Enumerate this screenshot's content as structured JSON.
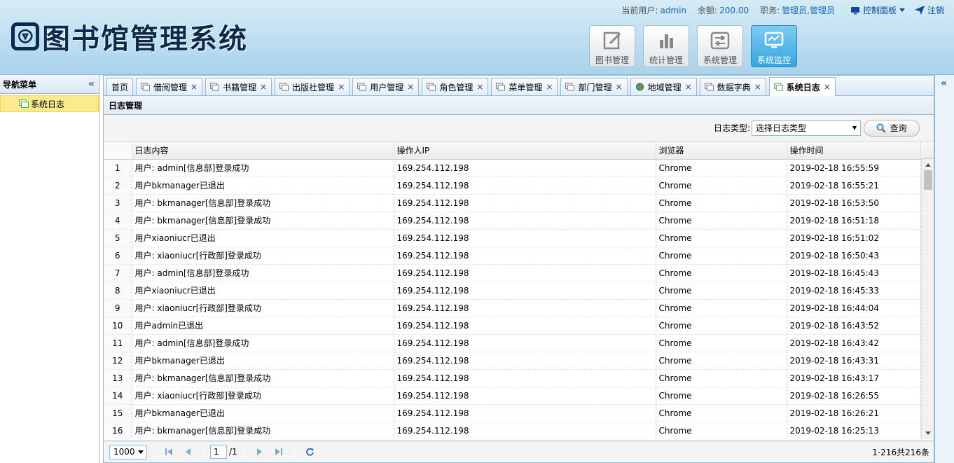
{
  "header": {
    "title": "图书馆管理系统",
    "user_label": "当前用户:",
    "user_value": "admin",
    "balance_label": "余额:",
    "balance_value": "200.00",
    "role_label": "职务:",
    "role_value": "管理员,管理员",
    "control_panel": "控制面板",
    "logout": "注销"
  },
  "modules": [
    {
      "label": "图书管理",
      "icon": "edit-icon"
    },
    {
      "label": "统计管理",
      "icon": "bar-chart-icon"
    },
    {
      "label": "系统管理",
      "icon": "sliders-icon"
    },
    {
      "label": "系统监控",
      "icon": "monitor-icon",
      "active": true
    }
  ],
  "sidebar": {
    "title": "导航菜单",
    "items": [
      {
        "label": "系统日志"
      }
    ]
  },
  "tabs": [
    {
      "label": "首页",
      "closable": false
    },
    {
      "label": "借阅管理",
      "closable": true
    },
    {
      "label": "书籍管理",
      "closable": true
    },
    {
      "label": "出版社管理",
      "closable": true
    },
    {
      "label": "用户管理",
      "closable": true
    },
    {
      "label": "角色管理",
      "closable": true
    },
    {
      "label": "菜单管理",
      "closable": true
    },
    {
      "label": "部门管理",
      "closable": true
    },
    {
      "label": "地域管理",
      "closable": true,
      "globe": true
    },
    {
      "label": "数据字典",
      "closable": true
    },
    {
      "label": "系统日志",
      "closable": true,
      "active": true
    }
  ],
  "panel": {
    "title": "日志管理",
    "filter_label": "日志类型:",
    "filter_placeholder": "选择日志类型",
    "search_button": "查询"
  },
  "table": {
    "columns": [
      "日志内容",
      "操作人IP",
      "浏览器",
      "操作时间"
    ],
    "rows": [
      [
        "1",
        "用户: admin[信息部]登录成功",
        "169.254.112.198",
        "Chrome",
        "2019-02-18 16:55:59"
      ],
      [
        "2",
        "用户bkmanager已退出",
        "169.254.112.198",
        "Chrome",
        "2019-02-18 16:55:21"
      ],
      [
        "3",
        "用户: bkmanager[信息部]登录成功",
        "169.254.112.198",
        "Chrome",
        "2019-02-18 16:53:50"
      ],
      [
        "4",
        "用户: bkmanager[信息部]登录成功",
        "169.254.112.198",
        "Chrome",
        "2019-02-18 16:51:18"
      ],
      [
        "5",
        "用户xiaoniucr已退出",
        "169.254.112.198",
        "Chrome",
        "2019-02-18 16:51:02"
      ],
      [
        "6",
        "用户: xiaoniucr[行政部]登录成功",
        "169.254.112.198",
        "Chrome",
        "2019-02-18 16:50:43"
      ],
      [
        "7",
        "用户: admin[信息部]登录成功",
        "169.254.112.198",
        "Chrome",
        "2019-02-18 16:45:43"
      ],
      [
        "8",
        "用户xiaoniucr已退出",
        "169.254.112.198",
        "Chrome",
        "2019-02-18 16:45:33"
      ],
      [
        "9",
        "用户: xiaoniucr[行政部]登录成功",
        "169.254.112.198",
        "Chrome",
        "2019-02-18 16:44:04"
      ],
      [
        "10",
        "用户admin已退出",
        "169.254.112.198",
        "Chrome",
        "2019-02-18 16:43:52"
      ],
      [
        "11",
        "用户: admin[信息部]登录成功",
        "169.254.112.198",
        "Chrome",
        "2019-02-18 16:43:42"
      ],
      [
        "12",
        "用户bkmanager已退出",
        "169.254.112.198",
        "Chrome",
        "2019-02-18 16:43:31"
      ],
      [
        "13",
        "用户: bkmanager[信息部]登录成功",
        "169.254.112.198",
        "Chrome",
        "2019-02-18 16:43:17"
      ],
      [
        "14",
        "用户: xiaoniucr[行政部]登录成功",
        "169.254.112.198",
        "Chrome",
        "2019-02-18 16:26:55"
      ],
      [
        "15",
        "用户bkmanager已退出",
        "169.254.112.198",
        "Chrome",
        "2019-02-18 16:26:21"
      ],
      [
        "16",
        "用户: bkmanager[信息部]登录成功",
        "169.254.112.198",
        "Chrome",
        "2019-02-18 16:25:13"
      ]
    ]
  },
  "pager": {
    "page_size": "1000",
    "page": "1",
    "page_total": "/1",
    "info": "1-216共216条"
  },
  "colors": {
    "accent": "#35a6e0",
    "brand": "#0b2a4f",
    "selected": "#fbeb8e"
  }
}
